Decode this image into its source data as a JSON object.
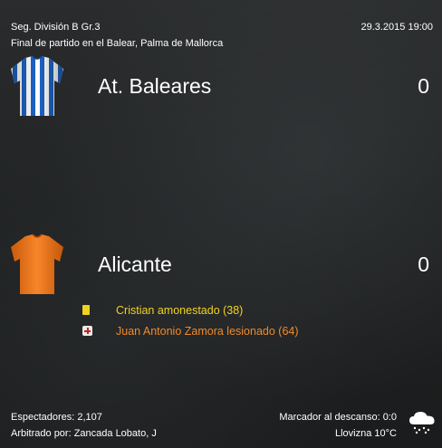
{
  "header": {
    "competition": "Seg. División B Gr.3",
    "status_venue": "Final de partido en el Balear, Palma de Mallorca",
    "datetime": "29.3.2015 19:00"
  },
  "home": {
    "name": "At. Baleares",
    "score": "0",
    "shirt_icon": "striped-shirt-icon",
    "colors": {
      "primary": "#1e63c4",
      "secondary": "#ffffff"
    }
  },
  "away": {
    "name": "Alicante",
    "score": "0",
    "shirt_icon": "plain-shirt-icon",
    "colors": {
      "primary": "#f07a1a"
    }
  },
  "events": [
    {
      "type": "yellow-card",
      "icon": "yellow-card-icon",
      "text": "Cristian amonestado (38)",
      "color": "#f3d21d"
    },
    {
      "type": "injury",
      "icon": "injury-icon",
      "text": "Juan Antonio Zamora lesionado (64)",
      "color": "#f08a2a"
    }
  ],
  "footer": {
    "spectators": "Espectadores: 2,107",
    "referee": "Arbitrado por: Zancada Lobato, J",
    "halftime": "Marcador al descanso: 0:0",
    "weather": "Llovizna 10°C",
    "weather_icon": "drizzle-cloud-icon"
  }
}
